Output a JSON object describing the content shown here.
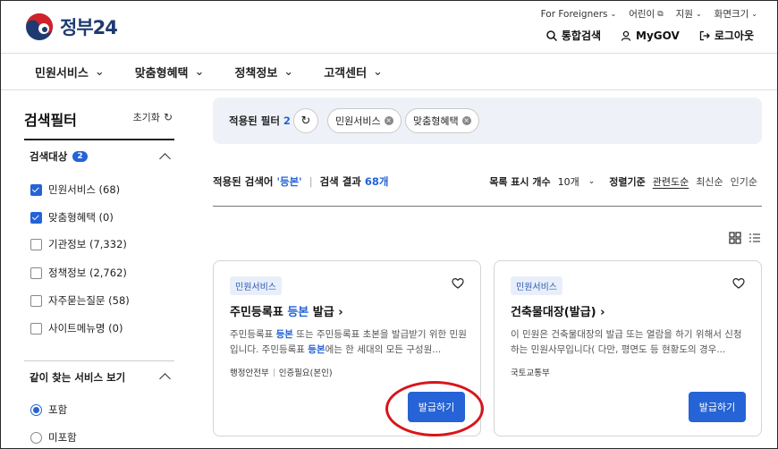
{
  "header": {
    "logo_text": "정부24",
    "util": [
      "For Foreigners",
      "어린이",
      "지원",
      "화면크기"
    ],
    "actions": [
      "통합검색",
      "MyGOV",
      "로그아웃"
    ]
  },
  "menu": [
    "민원서비스",
    "맞춤형혜택",
    "정책정보",
    "고객센터"
  ],
  "sidebar": {
    "title": "검색필터",
    "reset": "초기화",
    "target_label": "검색대상",
    "target_badge": "2",
    "checkboxes": [
      {
        "label": "민원서비스 (68)",
        "checked": true
      },
      {
        "label": "맞춤형혜택 (0)",
        "checked": true
      },
      {
        "label": "기관정보 (7,332)",
        "checked": false
      },
      {
        "label": "정책정보 (2,762)",
        "checked": false
      },
      {
        "label": "자주묻는질문 (58)",
        "checked": false
      },
      {
        "label": "사이트메뉴명 (0)",
        "checked": false
      }
    ],
    "related_label": "같이 찾는 서비스 보기",
    "radios": [
      {
        "label": "포함",
        "checked": true
      },
      {
        "label": "미포함",
        "checked": false
      }
    ]
  },
  "filter": {
    "label": "적용된 필터",
    "count": "2",
    "chips": [
      "민원서비스",
      "맞춤형혜택"
    ]
  },
  "results": {
    "prefix": "적용된 검색어",
    "keyword": "'등본'",
    "result_label": "검색 결과",
    "count": "68개",
    "per_page_label": "목록 표시 개수",
    "per_page_value": "10개",
    "sort_label": "정렬기준",
    "sort_options": [
      "관련도순",
      "최신순",
      "인기순"
    ]
  },
  "cards": [
    {
      "tag": "민원서비스",
      "title_pre": "주민등록표 ",
      "title_hl": "등본",
      "title_post": " 발급",
      "desc_1": "주민등록표 ",
      "desc_hl1": "등본",
      "desc_2": " 또는 주민등록표 초본을 발급받기 위한 민원입니다. 주민등록표 ",
      "desc_hl2": "등본",
      "desc_3": "에는 한 세대의 모든 구성원...",
      "meta": [
        "행정안전부",
        "인증필요(본인)"
      ],
      "button": "발급하기"
    },
    {
      "tag": "민원서비스",
      "title": "건축물대장(발급)",
      "desc": "이 민원은 건축물대장의 발급 또는 열람을 하기 위해서 신청하는 민원사무입니다( 다만, 평면도 등 현황도의 경우...",
      "meta": [
        "국토교통부"
      ],
      "button": "발급하기"
    }
  ],
  "colors": {
    "accent": "#2563d6",
    "brand": "#1f3a70",
    "highlight": "#d9141b"
  }
}
